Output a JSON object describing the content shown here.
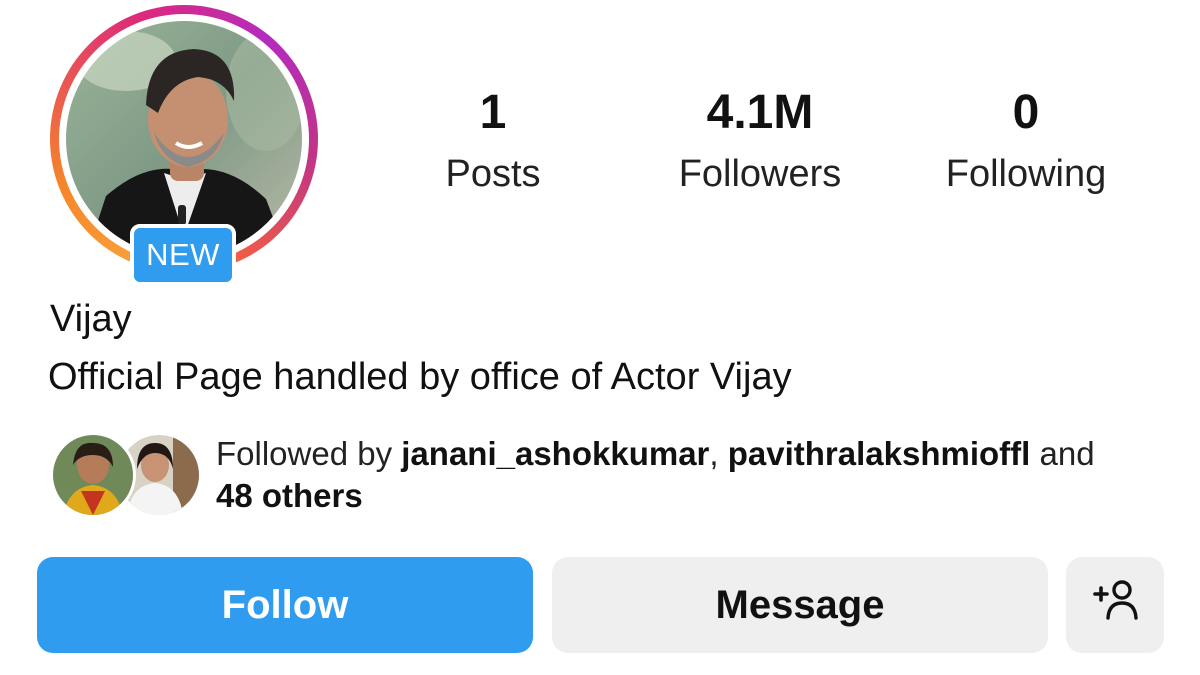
{
  "profile": {
    "avatar_icon": "profile-photo",
    "story_ring_colors": [
      "#f9a13a",
      "#dd2a7b",
      "#b42bbf"
    ],
    "badge": "NEW",
    "name": "Vijay",
    "bio": "Official Page handled by office of Actor Vijay"
  },
  "stats": {
    "posts": {
      "value": "1",
      "label": "Posts"
    },
    "followers": {
      "value": "4.1M",
      "label": "Followers"
    },
    "following": {
      "value": "0",
      "label": "Following"
    }
  },
  "followed_by": {
    "prefix": "Followed by ",
    "users": [
      "janani_ashokkumar",
      "pavithralakshmioffl"
    ],
    "separator": ", ",
    "conjunction": " and",
    "others": "48 others"
  },
  "actions": {
    "follow_label": "Follow",
    "message_label": "Message",
    "suggest_icon": "add-person-icon"
  },
  "colors": {
    "primary": "#2f9cf0",
    "secondary_button": "#efefef",
    "text": "#111111"
  }
}
